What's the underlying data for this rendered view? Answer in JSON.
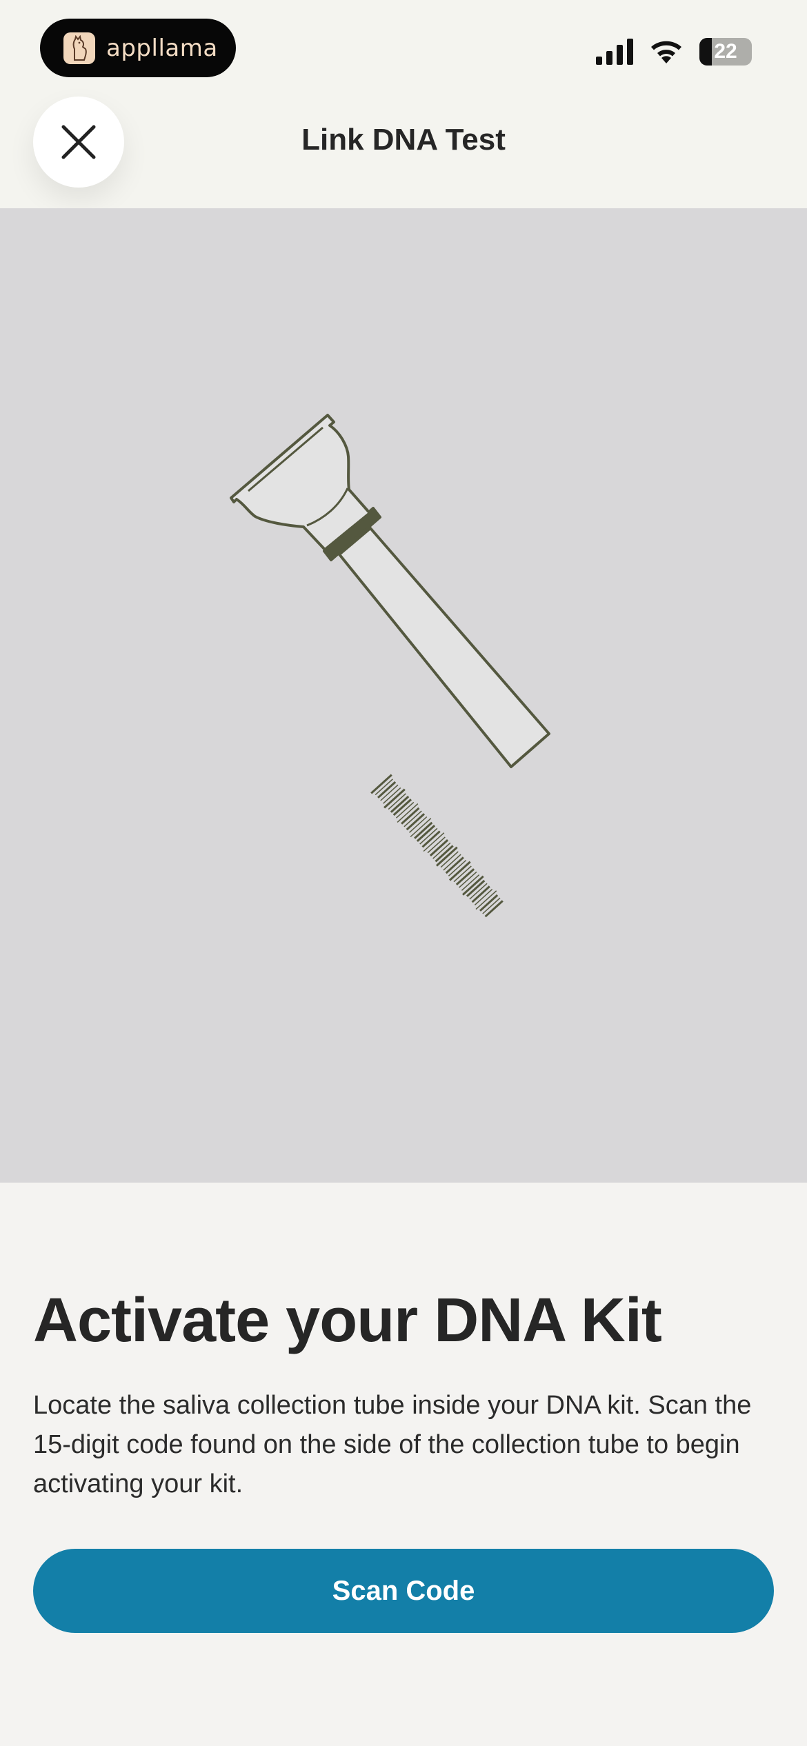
{
  "status_bar": {
    "app_badge": "appllama",
    "battery_level": "22"
  },
  "header": {
    "title": "Link DNA Test",
    "close_icon": "close-icon"
  },
  "hero": {
    "illustration": "saliva-collection-tube-illustration"
  },
  "content": {
    "headline": "Activate your DNA Kit",
    "body": "Locate the saliva collection tube inside your DNA kit. Scan the 15-digit code found on the side of the collection tube to begin activating your kit."
  },
  "actions": {
    "scan_button_label": "Scan Code"
  },
  "colors": {
    "accent": "#137fa8",
    "hero_background": "#d8d7d9",
    "illustration_stroke": "#54583f"
  }
}
